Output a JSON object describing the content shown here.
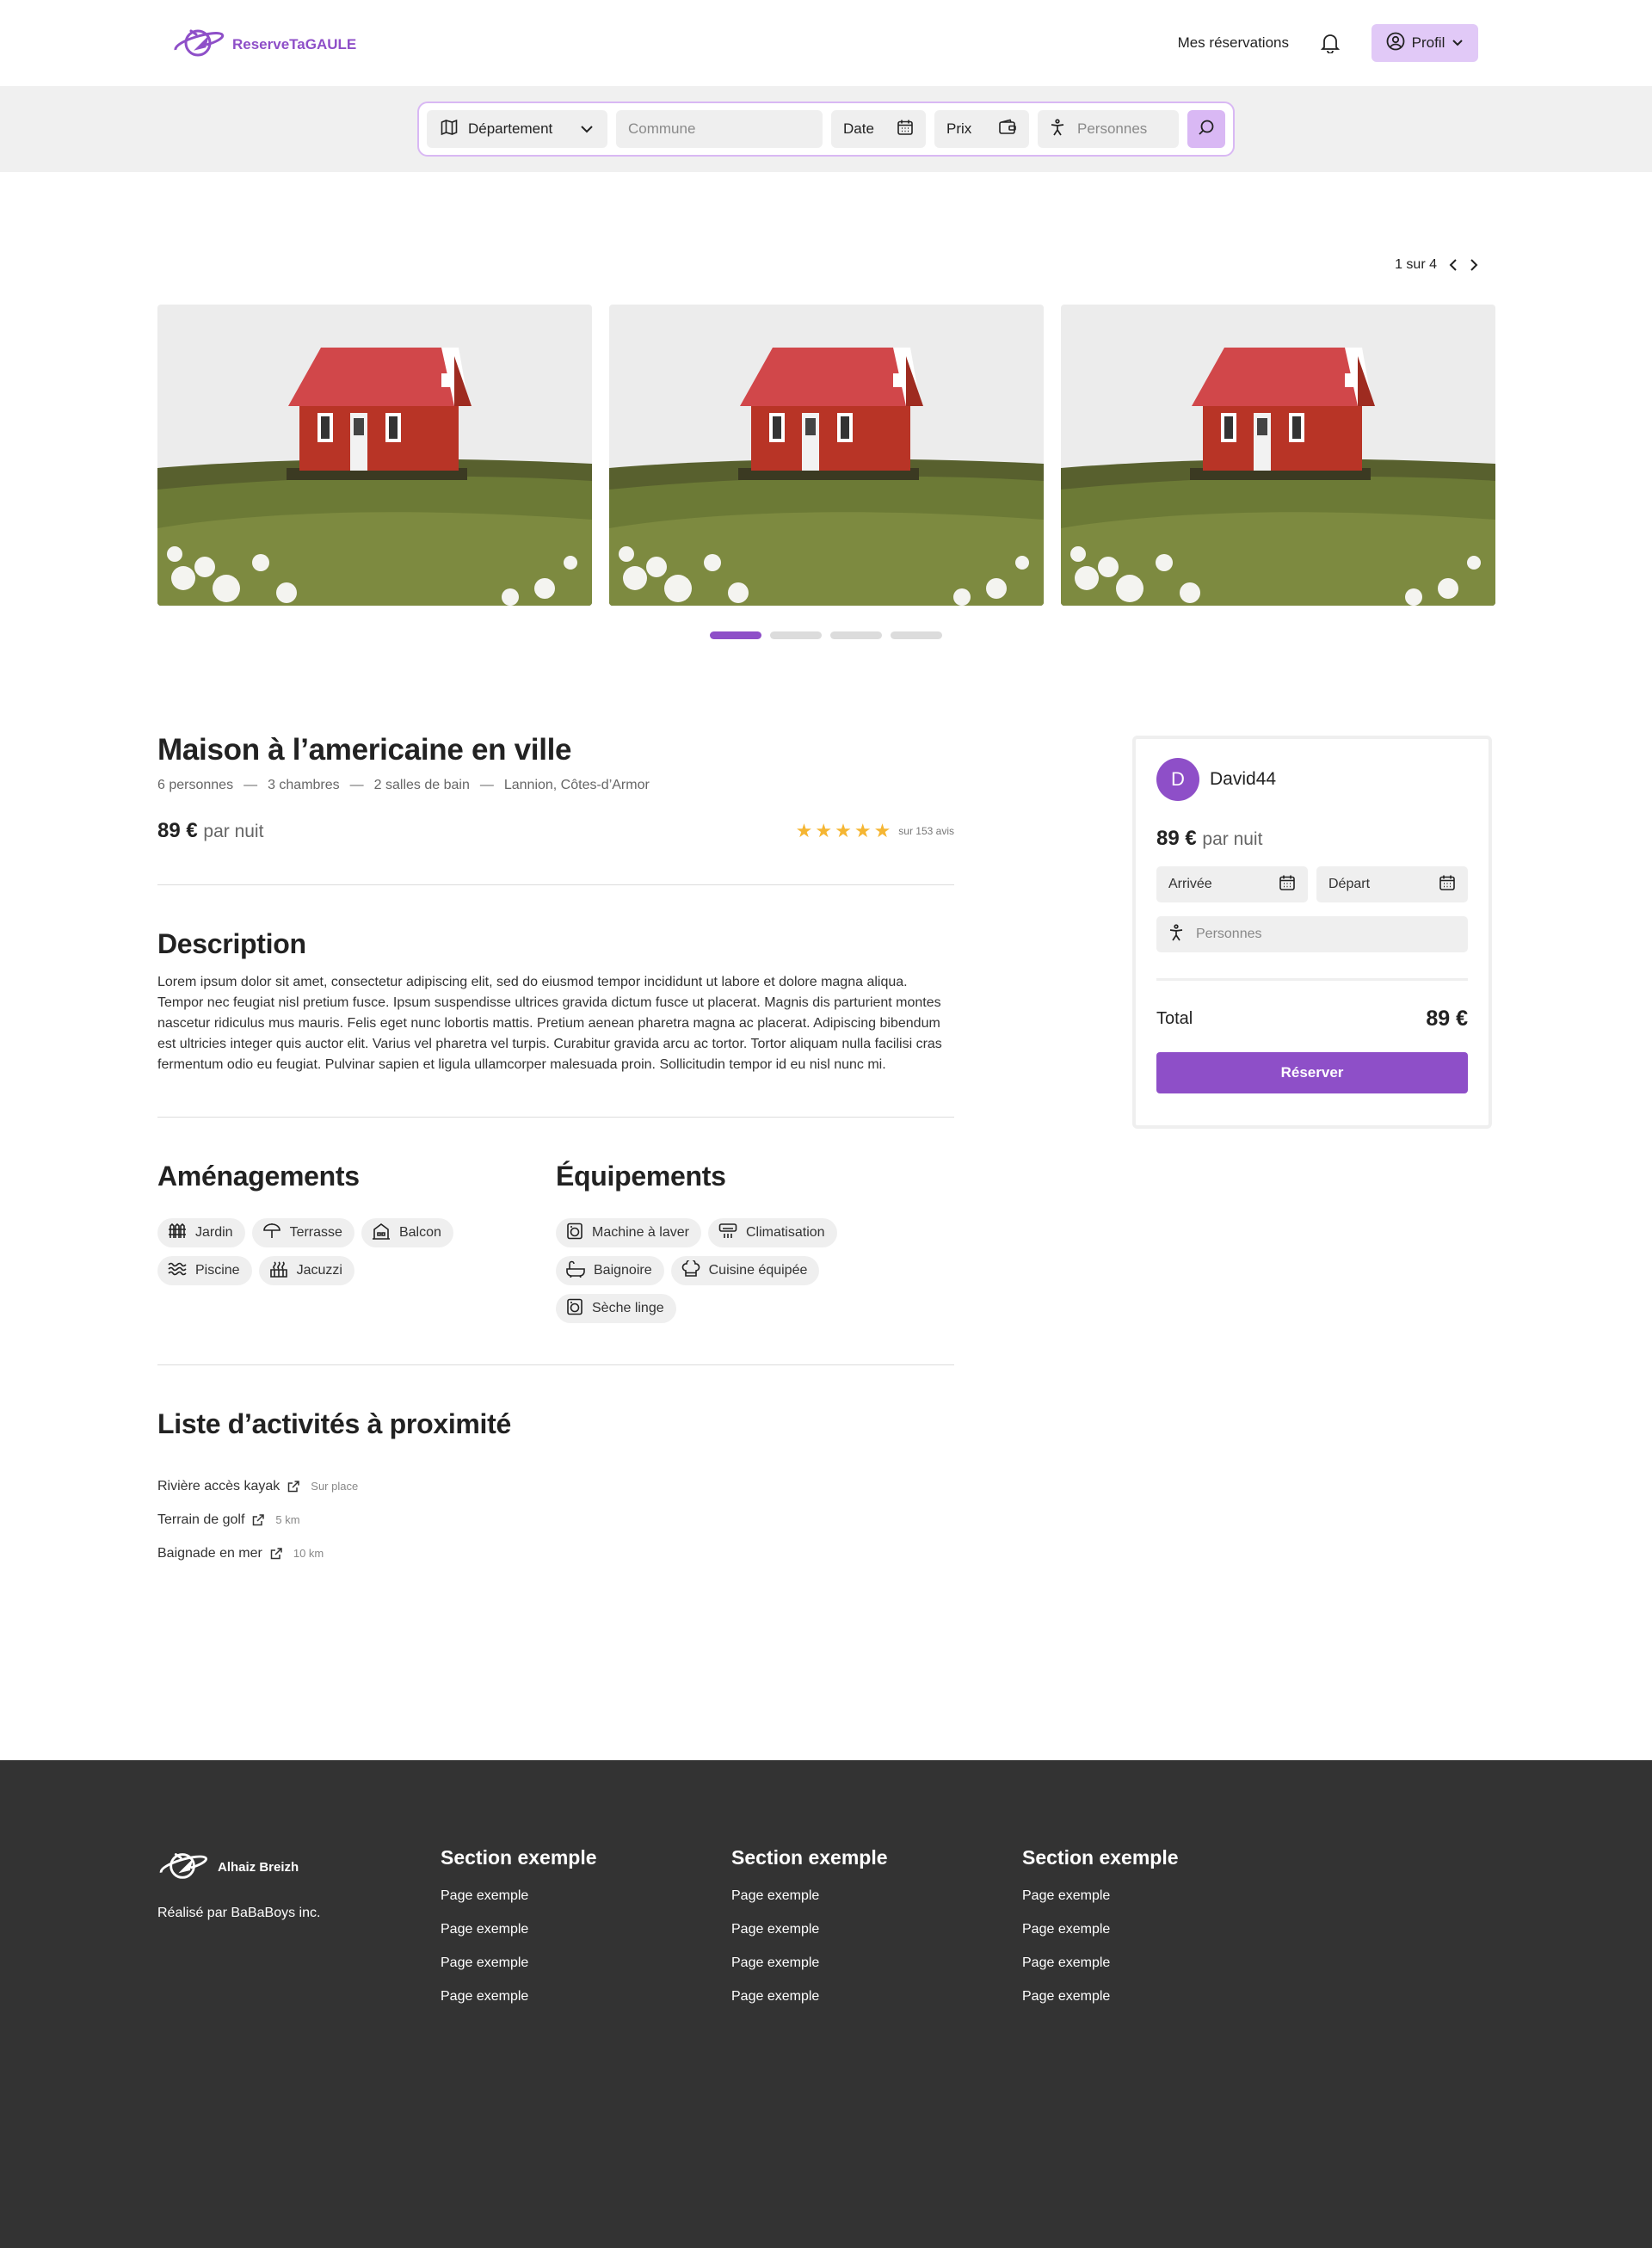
{
  "header": {
    "logo_text": "ReserveTaGAULE",
    "nav_reservations": "Mes réservations",
    "profile_label": "Profil"
  },
  "search": {
    "department_label": "Département",
    "commune_placeholder": "Commune",
    "date_label": "Date",
    "price_label": "Prix",
    "persons_placeholder": "Personnes"
  },
  "carousel": {
    "pager_text": "1 sur 4",
    "photo_count": 3,
    "page_count": 4,
    "active_page": 1
  },
  "listing": {
    "title": "Maison à l’americaine en ville",
    "meta": [
      "6 personnes",
      "3 chambres",
      "2 salles de bain",
      "Lannion, Côtes-d’Armor"
    ],
    "meta_separator": "—",
    "price": "89 €",
    "price_unit": "par nuit",
    "rating_stars": 5,
    "reviews": "sur 153 avis"
  },
  "description": {
    "heading": "Description",
    "text": "Lorem ipsum dolor sit amet, consectetur adipiscing elit, sed do eiusmod tempor incididunt ut labore et dolore magna aliqua. Tempor nec feugiat nisl pretium fusce. Ipsum suspendisse ultrices gravida dictum fusce ut placerat. Magnis dis parturient montes nascetur ridiculus mus mauris. Felis eget nunc lobortis mattis. Pretium aenean pharetra magna ac placerat. Adipiscing bibendum est ultricies integer quis auctor elit. Varius vel pharetra vel turpis. Curabitur gravida arcu ac tortor. Tortor aliquam nulla facilisi cras fermentum odio eu feugiat. Pulvinar sapien et ligula ullamcorper malesuada proin. Sollicitudin tempor id eu nisl nunc mi."
  },
  "amenagements": {
    "heading": "Aménagements",
    "items": [
      {
        "label": "Jardin",
        "icon": "fence-icon"
      },
      {
        "label": "Terrasse",
        "icon": "umbrella-icon"
      },
      {
        "label": "Balcon",
        "icon": "building-icon"
      },
      {
        "label": "Piscine",
        "icon": "waves-icon"
      },
      {
        "label": "Jacuzzi",
        "icon": "hot-tub-icon"
      }
    ]
  },
  "equipements": {
    "heading": "Équipements",
    "items": [
      {
        "label": "Machine à laver",
        "icon": "washing-machine-icon"
      },
      {
        "label": "Climatisation",
        "icon": "air-conditioner-icon"
      },
      {
        "label": "Baignoire",
        "icon": "bathtub-icon"
      },
      {
        "label": "Cuisine équipée",
        "icon": "chef-hat-icon"
      },
      {
        "label": "Sèche linge",
        "icon": "dryer-icon"
      }
    ]
  },
  "activities": {
    "heading": "Liste d’activités à proximité",
    "items": [
      {
        "name": "Rivière accès kayak",
        "distance": "Sur place"
      },
      {
        "name": "Terrain de golf",
        "distance": "5 km"
      },
      {
        "name": "Baignade en mer",
        "distance": "10 km"
      }
    ]
  },
  "booking": {
    "host_initial": "D",
    "host_name": "David44",
    "price": "89 €",
    "price_unit": "par nuit",
    "arrival_label": "Arrivée",
    "departure_label": "Départ",
    "persons_placeholder": "Personnes",
    "total_label": "Total",
    "total_value": "89 €",
    "reserve_label": "Réserver"
  },
  "footer": {
    "logo_text": "Alhaiz Breizh",
    "credit": "Réalisé par BaBaBoys inc.",
    "sections": [
      {
        "title": "Section exemple",
        "links": [
          "Page exemple",
          "Page exemple",
          "Page exemple",
          "Page exemple"
        ]
      },
      {
        "title": "Section exemple",
        "links": [
          "Page exemple",
          "Page exemple",
          "Page exemple",
          "Page exemple"
        ]
      },
      {
        "title": "Section exemple",
        "links": [
          "Page exemple",
          "Page exemple",
          "Page exemple",
          "Page exemple"
        ]
      }
    ]
  },
  "colors": {
    "brand": "#8e4fc8",
    "brand_light": "#e1c9f7",
    "star": "#f5b633",
    "footer_bg": "#333333"
  }
}
